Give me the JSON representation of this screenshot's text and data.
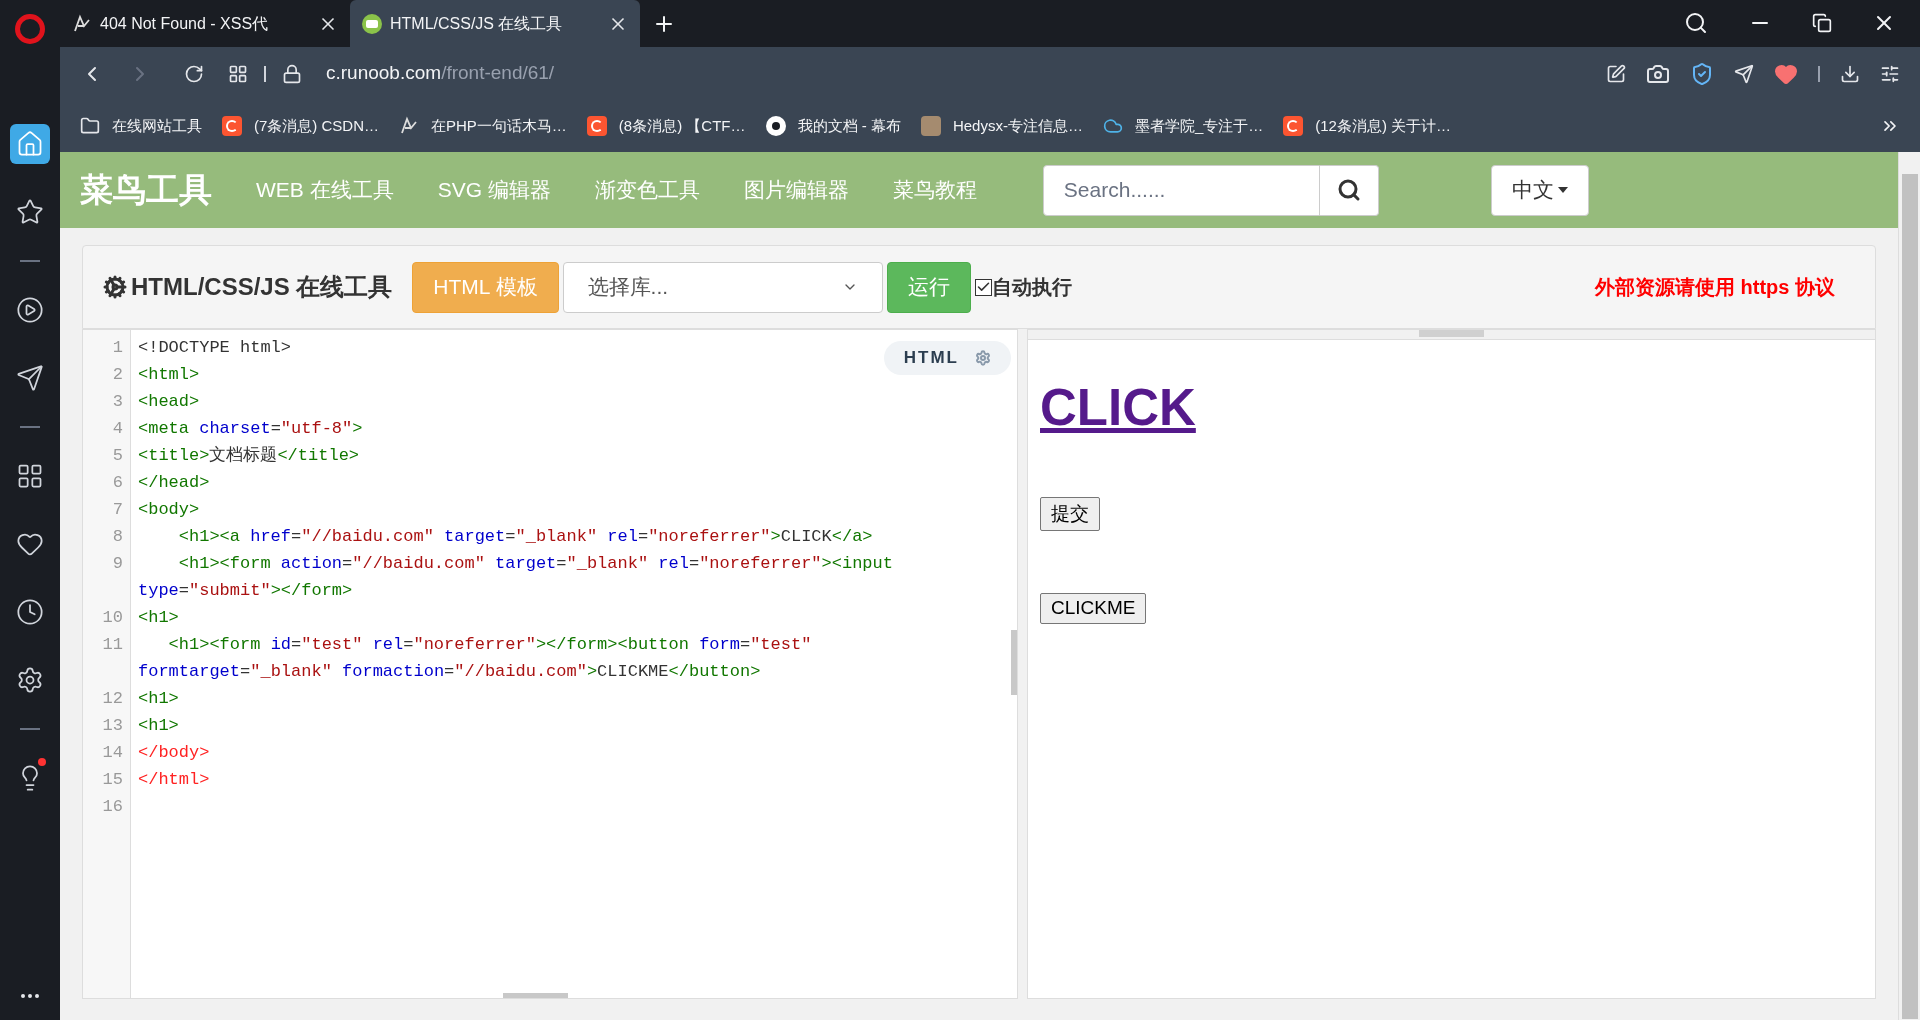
{
  "browser": {
    "tabs": [
      {
        "title": "404 Not Found - XSS代",
        "kind": "xss",
        "selected": false
      },
      {
        "title": "HTML/CSS/JS 在线工具",
        "kind": "runoob",
        "selected": true
      }
    ],
    "address": {
      "host": "c.runoob.com",
      "path": "/front-end/61/"
    },
    "bookmarks": [
      {
        "label": "在线网站工具",
        "kind": "folder"
      },
      {
        "label": "(7条消息) CSDN…",
        "kind": "csdn"
      },
      {
        "label": "在PHP一句话木马…",
        "kind": "xss"
      },
      {
        "label": "(8条消息) 【CTF…",
        "kind": "csdn"
      },
      {
        "label": "我的文档 - 幕布",
        "kind": "mubu"
      },
      {
        "label": "Hedysx-专注信息…",
        "kind": "avatar"
      },
      {
        "label": "墨者学院_专注于…",
        "kind": "cloud"
      },
      {
        "label": "(12条消息) 关于计…",
        "kind": "csdn"
      }
    ],
    "sidebar": [
      {
        "kind": "home",
        "selected": true
      },
      {
        "kind": "star",
        "selected": false
      },
      {
        "kind": "divider"
      },
      {
        "kind": "play",
        "selected": false
      },
      {
        "kind": "send",
        "selected": false
      },
      {
        "kind": "divider"
      },
      {
        "kind": "grid",
        "selected": false
      },
      {
        "kind": "heart",
        "selected": false
      },
      {
        "kind": "clock",
        "selected": false
      },
      {
        "kind": "settings",
        "selected": false
      },
      {
        "kind": "divider"
      },
      {
        "kind": "bulb",
        "selected": false,
        "badge": true
      }
    ]
  },
  "site": {
    "logo": "菜鸟工具",
    "nav": [
      "WEB 在线工具",
      "SVG 编辑器",
      "渐变色工具",
      "图片编辑器",
      "菜鸟教程"
    ],
    "search": {
      "placeholder": "Search......"
    },
    "language": "中文"
  },
  "toolbar": {
    "title": "HTML/CSS/JS 在线工具",
    "template_button": "HTML 模板",
    "library_select": "选择库...",
    "run_button": "运行",
    "auto_run": {
      "label": "自动执行",
      "checked": true
    },
    "notice": "外部资源请使用 https 协议"
  },
  "editor": {
    "mode": "HTML",
    "lines": [
      {
        "num": "1",
        "code": [
          {
            "t": "<!DOCTYPE html>",
            "kind": "text"
          }
        ]
      },
      {
        "num": "2",
        "code": [
          {
            "t": "<html>",
            "kind": "tag"
          }
        ]
      },
      {
        "num": "3",
        "code": [
          {
            "t": "<head>",
            "kind": "tag"
          }
        ]
      },
      {
        "num": "4",
        "code": [
          {
            "t": "<meta ",
            "kind": "tag"
          },
          {
            "t": "charset",
            "kind": "attr"
          },
          {
            "t": "=",
            "kind": "text"
          },
          {
            "t": "\"utf-8\"",
            "kind": "string"
          },
          {
            "t": ">",
            "kind": "tag"
          }
        ]
      },
      {
        "num": "5",
        "code": [
          {
            "t": "<title>",
            "kind": "tag"
          },
          {
            "t": "文档标题",
            "kind": "text"
          },
          {
            "t": "</title>",
            "kind": "tag"
          }
        ]
      },
      {
        "num": "6",
        "code": [
          {
            "t": "</head>",
            "kind": "tag"
          }
        ]
      },
      {
        "num": "7",
        "code": [
          {
            "t": "<body>",
            "kind": "tag"
          }
        ]
      },
      {
        "num": "8",
        "code": [
          {
            "t": "    <h1><a ",
            "kind": "tag"
          },
          {
            "t": "href",
            "kind": "attr"
          },
          {
            "t": "=",
            "kind": "text"
          },
          {
            "t": "\"//baidu.com\"",
            "kind": "string"
          },
          {
            "t": " target",
            "kind": "attr"
          },
          {
            "t": "=",
            "kind": "text"
          },
          {
            "t": "\"_blank\"",
            "kind": "string"
          },
          {
            "t": " rel",
            "kind": "attr"
          },
          {
            "t": "=",
            "kind": "text"
          },
          {
            "t": "\"noreferrer\"",
            "kind": "string"
          },
          {
            "t": ">",
            "kind": "tag"
          },
          {
            "t": "CLICK",
            "kind": "text"
          },
          {
            "t": "</a>",
            "kind": "tag"
          }
        ]
      },
      {
        "num": "9",
        "code": [
          {
            "t": "    <h1><form ",
            "kind": "tag"
          },
          {
            "t": "action",
            "kind": "attr"
          },
          {
            "t": "=",
            "kind": "text"
          },
          {
            "t": "\"//baidu.com\"",
            "kind": "string"
          },
          {
            "t": " target",
            "kind": "attr"
          },
          {
            "t": "=",
            "kind": "text"
          },
          {
            "t": "\"_blank\"",
            "kind": "string"
          },
          {
            "t": " rel",
            "kind": "attr"
          },
          {
            "t": "=",
            "kind": "text"
          },
          {
            "t": "\"noreferrer\"",
            "kind": "string"
          },
          {
            "t": "><input",
            "kind": "tag"
          }
        ],
        "wrapped": [
          {
            "t": "type",
            "kind": "attr"
          },
          {
            "t": "=",
            "kind": "text"
          },
          {
            "t": "\"submit\"",
            "kind": "string"
          },
          {
            "t": "></form>",
            "kind": "tag"
          }
        ]
      },
      {
        "num": "10",
        "code": [
          {
            "t": "<h1>",
            "kind": "tag"
          }
        ]
      },
      {
        "num": "11",
        "code": [
          {
            "t": "   <h1><form ",
            "kind": "tag"
          },
          {
            "t": "id",
            "kind": "attr"
          },
          {
            "t": "=",
            "kind": "text"
          },
          {
            "t": "\"test\"",
            "kind": "string"
          },
          {
            "t": " rel",
            "kind": "attr"
          },
          {
            "t": "=",
            "kind": "text"
          },
          {
            "t": "\"noreferrer\"",
            "kind": "string"
          },
          {
            "t": "></form><button ",
            "kind": "tag"
          },
          {
            "t": "form",
            "kind": "attr"
          },
          {
            "t": "=",
            "kind": "text"
          },
          {
            "t": "\"test\"",
            "kind": "string"
          }
        ],
        "wrapped": [
          {
            "t": "formtarget",
            "kind": "attr"
          },
          {
            "t": "=",
            "kind": "text"
          },
          {
            "t": "\"_blank\"",
            "kind": "string"
          },
          {
            "t": " formaction",
            "kind": "attr"
          },
          {
            "t": "=",
            "kind": "text"
          },
          {
            "t": "\"//baidu.com\"",
            "kind": "string"
          },
          {
            "t": ">",
            "kind": "tag"
          },
          {
            "t": "CLICKME",
            "kind": "text"
          },
          {
            "t": "</button>",
            "kind": "tag"
          }
        ]
      },
      {
        "num": "12",
        "code": [
          {
            "t": "<h1>",
            "kind": "tag"
          }
        ]
      },
      {
        "num": "13",
        "code": [
          {
            "t": "<h1>",
            "kind": "tag"
          }
        ]
      },
      {
        "num": "14",
        "code": [
          {
            "t": "</body>",
            "kind": "error"
          }
        ]
      },
      {
        "num": "15",
        "code": [
          {
            "t": "</html>",
            "kind": "error"
          }
        ]
      },
      {
        "num": "16"
      }
    ]
  },
  "preview": {
    "link": "CLICK",
    "submit_button": "提交",
    "button": "CLICKME"
  }
}
